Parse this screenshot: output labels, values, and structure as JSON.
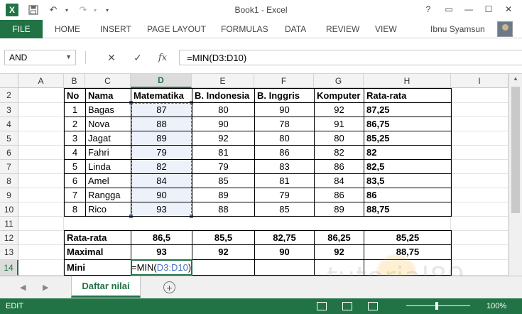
{
  "window": {
    "title": "Book1 - Excel",
    "help": "?",
    "restore": "▭",
    "minimize": "—",
    "maximize": "☐",
    "close": "✕"
  },
  "ribbon": {
    "file": "FILE",
    "tabs": [
      "HOME",
      "INSERT",
      "PAGE LAYOUT",
      "FORMULAS",
      "DATA",
      "REVIEW",
      "VIEW"
    ],
    "user": "Ibnu Syamsun"
  },
  "formula_bar": {
    "name_box": "AND",
    "cancel": "✕",
    "enter": "✓",
    "fx": "fx",
    "formula": "=MIN(D3:D10)"
  },
  "columns": [
    "A",
    "B",
    "C",
    "D",
    "E",
    "F",
    "G",
    "H",
    "I"
  ],
  "rows": [
    "2",
    "3",
    "4",
    "5",
    "6",
    "7",
    "8",
    "9",
    "10",
    "11",
    "12",
    "13",
    "14"
  ],
  "selected_column": "D",
  "selected_row": "14",
  "table": {
    "header": [
      "No",
      "Nama",
      "Matematika",
      "B. Indonesia",
      "B. Inggris",
      "Komputer",
      "Rata-rata"
    ],
    "rows": [
      [
        "1",
        "Bagas",
        "87",
        "80",
        "90",
        "92",
        "87,25"
      ],
      [
        "2",
        "Nova",
        "88",
        "90",
        "78",
        "91",
        "86,75"
      ],
      [
        "3",
        "Jagat",
        "89",
        "92",
        "80",
        "80",
        "85,25"
      ],
      [
        "4",
        "Fahri",
        "79",
        "81",
        "86",
        "82",
        "82"
      ],
      [
        "5",
        "Linda",
        "82",
        "79",
        "83",
        "86",
        "82,5"
      ],
      [
        "6",
        "Amel",
        "84",
        "85",
        "81",
        "84",
        "83,5"
      ],
      [
        "7",
        "Rangga",
        "90",
        "89",
        "79",
        "86",
        "86"
      ],
      [
        "8",
        "Rico",
        "93",
        "88",
        "85",
        "89",
        "88,75"
      ]
    ]
  },
  "summary": {
    "rows": [
      [
        "Rata-rata",
        "86,5",
        "85,5",
        "82,75",
        "86,25",
        "85,25"
      ],
      [
        "Maximal",
        "93",
        "92",
        "90",
        "92",
        "88,75"
      ]
    ],
    "mini_label": "Mini",
    "editing_prefix": "=MIN(",
    "editing_ref": "D3:D10",
    "editing_suffix": ")"
  },
  "sheet_tabs": [
    "Daftar nilai"
  ],
  "add_sheet": "+",
  "status": {
    "mode": "EDIT",
    "zoom": "100%"
  },
  "watermark": "tutorial89"
}
